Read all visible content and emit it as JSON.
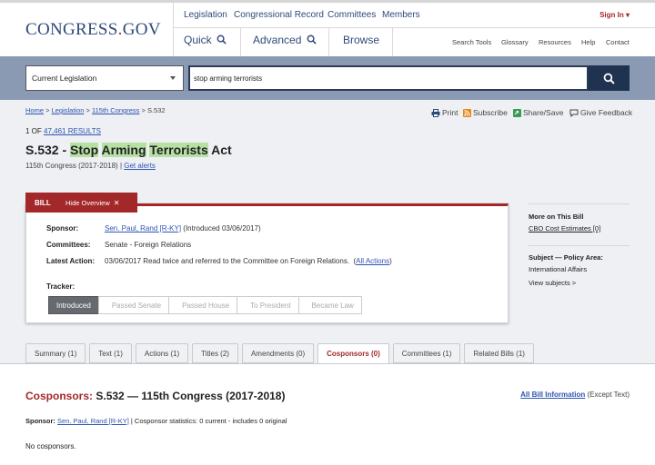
{
  "header": {
    "logo_main": "CONGRESS",
    "logo_dot": ".",
    "logo_tld": "GOV",
    "top_links": [
      "Legislation",
      "Congressional Record",
      "Committees",
      "Members"
    ],
    "sign_in": "Sign In ▾",
    "big_links": [
      "Quick",
      "Advanced",
      "Browse"
    ],
    "mini_links": [
      "Search Tools",
      "Glossary",
      "Resources",
      "Help",
      "Contact"
    ]
  },
  "search": {
    "scope": "Current Legislation",
    "query": "stop arming terrorists"
  },
  "breadcrumb": {
    "home": "Home",
    "sep": " > ",
    "legislation": "Legislation",
    "congress": "115th Congress",
    "current": "S.532"
  },
  "toolbar": {
    "print": "Print",
    "subscribe": "Subscribe",
    "share": "Share/Save",
    "feedback": "Give Feedback"
  },
  "results": {
    "prefix": "1 OF ",
    "count": "47,461 RESULTS"
  },
  "bill": {
    "number_prefix": "S.532 - ",
    "title_word1": "Stop",
    "title_word2": "Arming",
    "title_word3": "Terrorists",
    "title_rest": "Act",
    "congress": "115th Congress (2017-2018)",
    "divider": "|",
    "get_alerts": "Get alerts"
  },
  "overview": {
    "tab_label": "BILL",
    "hide_label": "Hide Overview",
    "close": "✕",
    "sponsor_label": "Sponsor:",
    "sponsor_name": "Sen. Paul, Rand [R-KY]",
    "sponsor_intro": "(Introduced 03/06/2017)",
    "committees_label": "Committees:",
    "committees_value": "Senate - Foreign Relations",
    "latest_label": "Latest Action:",
    "latest_value": "03/06/2017 Read twice and referred to the Committee on Foreign Relations.",
    "all_actions_open": "(",
    "all_actions": "All Actions",
    "all_actions_close": ")",
    "tracker_label": "Tracker:",
    "tracker_steps": [
      "Introduced",
      "Passed Senate",
      "Passed House",
      "To President",
      "Became Law"
    ]
  },
  "side": {
    "more_label": "More on This Bill",
    "cbo": "CBO Cost Estimates [0]",
    "subject_label": "Subject — Policy Area:",
    "subject_value": "International Affairs",
    "view_subjects": "View subjects >"
  },
  "tabs": [
    {
      "label": "Summary (1)"
    },
    {
      "label": "Text (1)"
    },
    {
      "label": "Actions (1)"
    },
    {
      "label": "Titles (2)"
    },
    {
      "label": "Amendments (0)"
    },
    {
      "label": "Cosponsors (0)"
    },
    {
      "label": "Committees (1)"
    },
    {
      "label": "Related Bills (1)"
    }
  ],
  "cosponsors": {
    "title_red": "Cosponsors:",
    "title_rest": " S.532 — 115th Congress (2017-2018)",
    "all_info": "All Bill Information",
    "all_info_suffix": " (Except Text)",
    "sponsor_label": "Sponsor:",
    "sponsor_name": "Sen. Paul, Rand [R-KY]",
    "stats": " | Cosponsor statistics: 0 current - includes 0 original",
    "none": "No cosponsors."
  },
  "colors": {
    "brand_red": "#a3282a",
    "brand_navy": "#2f4a7a",
    "search_band": "#8a9ab3",
    "highlight": "#b7e0a5"
  }
}
